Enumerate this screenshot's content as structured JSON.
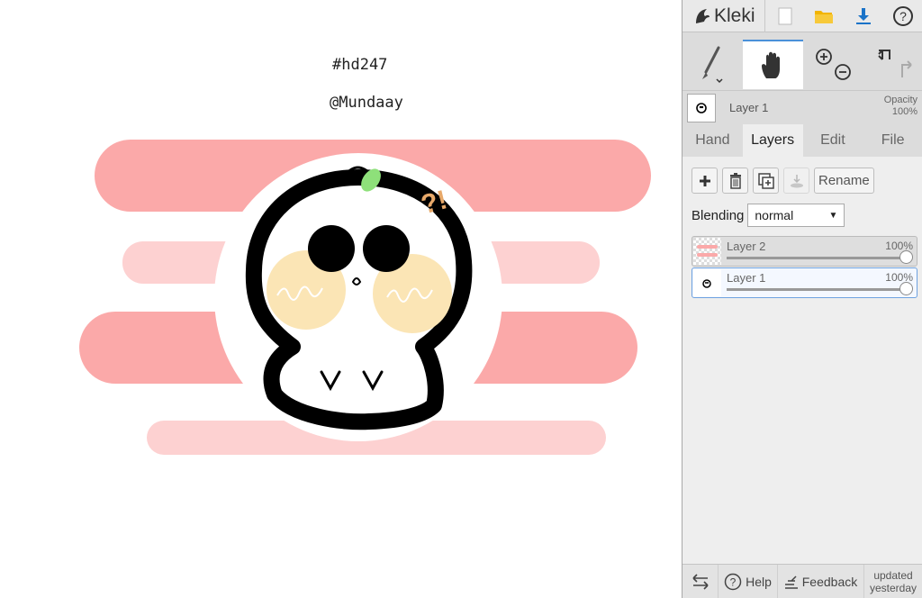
{
  "app": {
    "name": "Kleki"
  },
  "canvas": {
    "line1": "#hd247",
    "line2": "@Mundaay"
  },
  "layer_info": {
    "name": "Layer 1",
    "opacity_label": "Opacity",
    "opacity_value": "100%"
  },
  "tabs": [
    {
      "label": "Hand"
    },
    {
      "label": "Layers"
    },
    {
      "label": "Edit"
    },
    {
      "label": "File"
    }
  ],
  "layers_panel": {
    "rename_label": "Rename",
    "blending_label": "Blending",
    "blending_value": "normal",
    "layers": [
      {
        "name": "Layer 2",
        "opacity": "100%"
      },
      {
        "name": "Layer 1",
        "opacity": "100%"
      }
    ]
  },
  "footer": {
    "help_label": "Help",
    "feedback_label": "Feedback",
    "updated_line1": "updated",
    "updated_line2": "yesterday"
  },
  "colors": {
    "accent": "#1a73c8",
    "folder": "#f2b400",
    "stripe_dark": "#fba9a9",
    "stripe_light": "#fdd1d1",
    "cheek": "#fbe5b5",
    "sprout": "#8ee07a",
    "question": "#e8a96a"
  }
}
